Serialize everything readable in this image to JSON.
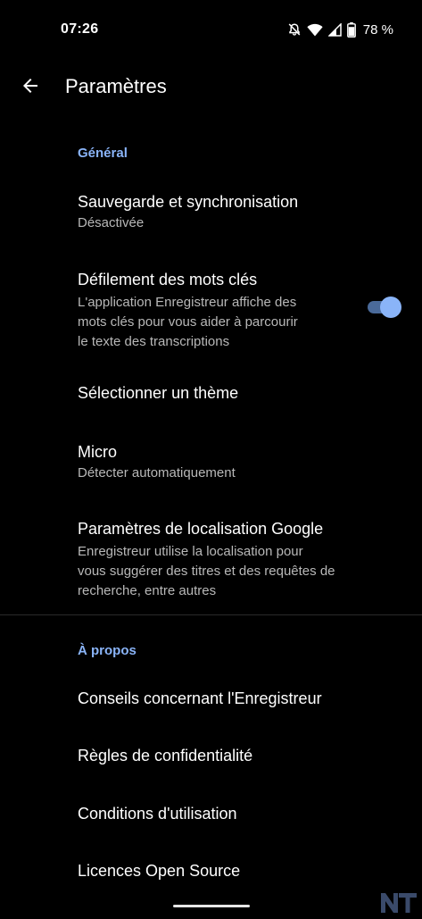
{
  "status": {
    "time": "07:26",
    "battery": "78 %"
  },
  "appbar": {
    "title": "Paramètres"
  },
  "sections": {
    "general": "Général",
    "about": "À propos"
  },
  "items": {
    "backup": {
      "title": "Sauvegarde et synchronisation",
      "subtitle": "Désactivée"
    },
    "keywords": {
      "title": "Défilement des mots clés",
      "subtitle_line1": "L'application Enregistreur affiche des",
      "subtitle_line2": "mots clés pour vous aider à parcourir",
      "subtitle_line3": "le texte des transcriptions",
      "enabled": true
    },
    "theme": {
      "title": "Sélectionner un thème"
    },
    "micro": {
      "title": "Micro",
      "subtitle": "Détecter automatiquement"
    },
    "location": {
      "title": "Paramètres de localisation Google",
      "subtitle_line1": "Enregistreur utilise la localisation pour",
      "subtitle_line2": "vous suggérer des titres et des requêtes de",
      "subtitle_line3": "recherche, entre autres"
    },
    "tips": {
      "title": "Conseils concernant l'Enregistreur"
    },
    "privacy": {
      "title": "Règles de confidentialité"
    },
    "terms": {
      "title": "Conditions d'utilisation"
    },
    "licenses": {
      "title": "Licences Open Source"
    }
  },
  "icons": {
    "back": "arrow-back-icon",
    "dnd": "bell-off-icon",
    "wifi": "wifi-icon",
    "signal": "signal-icon",
    "battery": "battery-icon"
  },
  "colors": {
    "accent": "#8ab4f8",
    "background": "#000000",
    "text": "#ffffff",
    "secondary": "#b8b8b8"
  }
}
